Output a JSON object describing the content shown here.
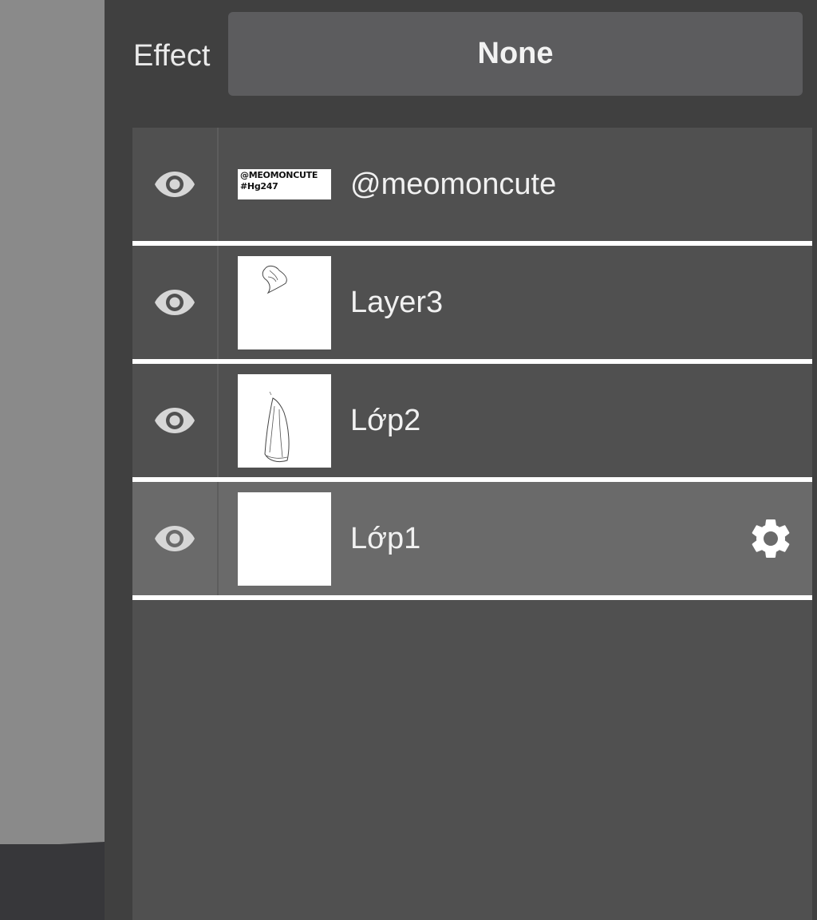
{
  "effect": {
    "label": "Effect",
    "value": "None"
  },
  "layers": [
    {
      "name": "@meomoncute",
      "visible": true,
      "selected": false,
      "thumbnail_text": [
        "@MEOMONCUTE",
        "#Hg247"
      ]
    },
    {
      "name": "Layer3",
      "visible": true,
      "selected": false
    },
    {
      "name": "Lớp2",
      "visible": true,
      "selected": false
    },
    {
      "name": "Lớp1",
      "visible": true,
      "selected": true
    }
  ],
  "icons": {
    "visibility": "eye-icon",
    "settings": "gear-icon"
  },
  "colors": {
    "panel_bg": "#404040",
    "list_bg": "#505050",
    "selected_bg": "#6a6a6a",
    "separator": "#ffffff"
  }
}
